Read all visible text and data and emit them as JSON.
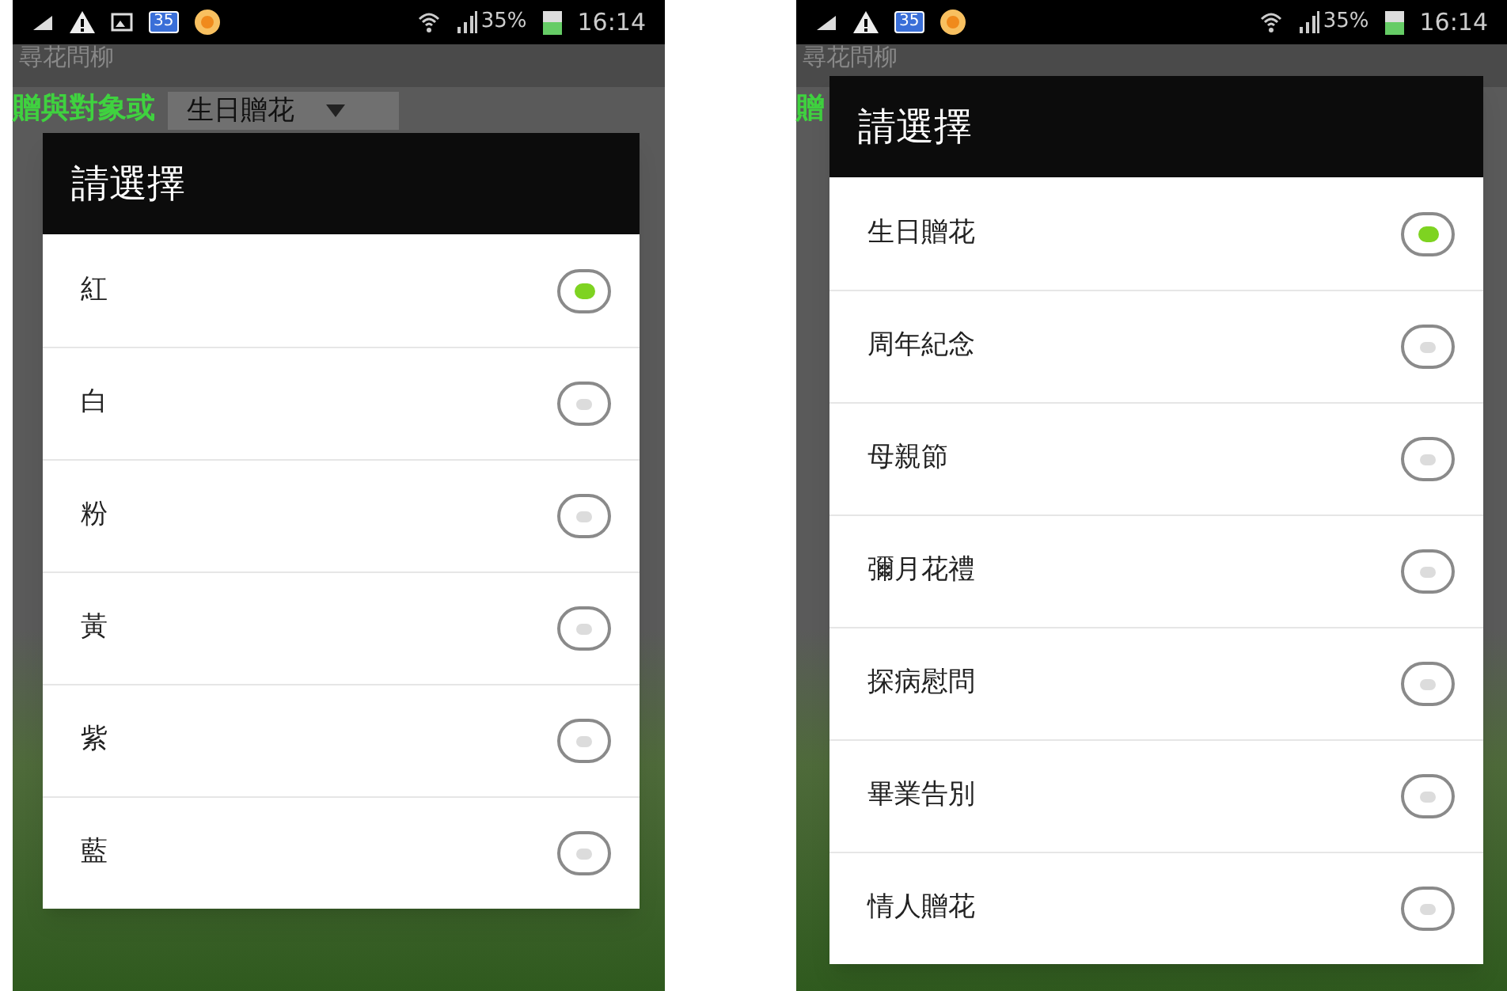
{
  "phones": [
    {
      "status_bar": {
        "battery": "35%",
        "time": "16:14",
        "calendar_day": "35"
      },
      "app_title": "尋花問柳",
      "background": {
        "label": "贈與對象或",
        "spinner": "生日贈花"
      },
      "dialog": {
        "title": "請選擇",
        "options": [
          {
            "label": "紅",
            "selected": true
          },
          {
            "label": "白",
            "selected": false
          },
          {
            "label": "粉",
            "selected": false
          },
          {
            "label": "黃",
            "selected": false
          },
          {
            "label": "紫",
            "selected": false
          },
          {
            "label": "藍",
            "selected": false
          }
        ]
      }
    },
    {
      "status_bar": {
        "battery": "35%",
        "time": "16:14",
        "calendar_day": "35"
      },
      "app_title": "尋花問柳",
      "background": {
        "label": "贈"
      },
      "dialog": {
        "title": "請選擇",
        "options": [
          {
            "label": "生日贈花",
            "selected": true
          },
          {
            "label": "周年紀念",
            "selected": false
          },
          {
            "label": "母親節",
            "selected": false
          },
          {
            "label": "彌月花禮",
            "selected": false
          },
          {
            "label": "探病慰問",
            "selected": false
          },
          {
            "label": "畢業告別",
            "selected": false
          },
          {
            "label": "情人贈花",
            "selected": false
          }
        ]
      }
    }
  ]
}
